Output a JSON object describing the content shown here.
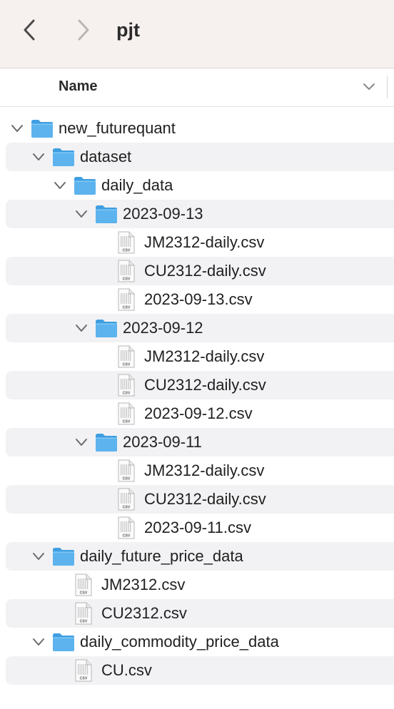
{
  "window": {
    "title": "pjt"
  },
  "header": {
    "name_column": "Name"
  },
  "tree": [
    {
      "label": "new_futurequant",
      "kind": "folder",
      "depth": 0,
      "expanded": true
    },
    {
      "label": "dataset",
      "kind": "folder",
      "depth": 1,
      "expanded": true
    },
    {
      "label": "daily_data",
      "kind": "folder",
      "depth": 2,
      "expanded": true
    },
    {
      "label": "2023-09-13",
      "kind": "folder",
      "depth": 3,
      "expanded": true
    },
    {
      "label": "JM2312-daily.csv",
      "kind": "file",
      "depth": 4
    },
    {
      "label": "CU2312-daily.csv",
      "kind": "file",
      "depth": 4
    },
    {
      "label": "2023-09-13.csv",
      "kind": "file",
      "depth": 4
    },
    {
      "label": "2023-09-12",
      "kind": "folder",
      "depth": 3,
      "expanded": true
    },
    {
      "label": "JM2312-daily.csv",
      "kind": "file",
      "depth": 4
    },
    {
      "label": "CU2312-daily.csv",
      "kind": "file",
      "depth": 4
    },
    {
      "label": "2023-09-12.csv",
      "kind": "file",
      "depth": 4
    },
    {
      "label": "2023-09-11",
      "kind": "folder",
      "depth": 3,
      "expanded": true
    },
    {
      "label": "JM2312-daily.csv",
      "kind": "file",
      "depth": 4
    },
    {
      "label": "CU2312-daily.csv",
      "kind": "file",
      "depth": 4
    },
    {
      "label": "2023-09-11.csv",
      "kind": "file",
      "depth": 4
    },
    {
      "label": "daily_future_price_data",
      "kind": "folder",
      "depth": 1,
      "expanded": true
    },
    {
      "label": "JM2312.csv",
      "kind": "file",
      "depth": 2
    },
    {
      "label": "CU2312.csv",
      "kind": "file",
      "depth": 2
    },
    {
      "label": "daily_commodity_price_data",
      "kind": "folder",
      "depth": 1,
      "expanded": true
    },
    {
      "label": "CU.csv",
      "kind": "file",
      "depth": 2
    }
  ],
  "icons": {
    "back": "chevron-left-icon",
    "forward": "chevron-right-icon",
    "sort": "chevron-down-icon",
    "folder": "folder-icon",
    "file": "csv-file-icon",
    "file_badge": "CSV"
  },
  "colors": {
    "toolbar_bg": "#f6f1ee",
    "folder_blue": "#5cb3ee",
    "stripe": "#f2f2f4"
  }
}
